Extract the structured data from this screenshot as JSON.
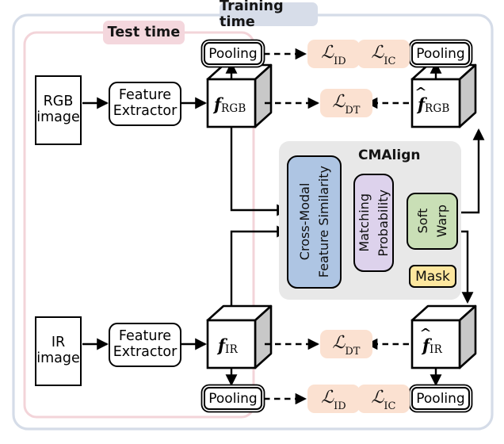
{
  "figure": {
    "kind": "architecture-diagram",
    "outer_frame_label": "Training time",
    "inner_frame_label": "Test time",
    "module_title": "CMAlign"
  },
  "colors": {
    "outer_frame_border": "#d5dce8",
    "outer_badge_bg": "#d7dde9",
    "inner_frame_border": "#f3d4d9",
    "inner_badge_bg": "#f4d7dd",
    "loss_bg": "#fbe1d1",
    "cmalign_bg": "#e8e8e8",
    "similarity_bg": "#aec5e3",
    "matching_bg": "#ddd2ec",
    "softwarp_bg": "#c9dfb6",
    "mask_bg": "#fde79f",
    "cube_side": "#c8c8c8",
    "cube_face": "#ffffff",
    "stroke": "#000000"
  },
  "rgb_branch": {
    "input_label_line1": "RGB",
    "input_label_line2": "image",
    "extractor_line1": "Feature",
    "extractor_line2": "Extractor",
    "feature_symbol": "f",
    "feature_subscript": "RGB",
    "pooling_label": "Pooling",
    "loss_id": "ID",
    "loss_dt": "DT"
  },
  "ir_branch": {
    "input_label_line1": "IR",
    "input_label_line2": "image",
    "extractor_line1": "Feature",
    "extractor_line2": "Extractor",
    "feature_symbol": "f",
    "feature_subscript": "IR",
    "pooling_label": "Pooling",
    "loss_id": "ID",
    "loss_dt": "DT"
  },
  "aligned_rgb": {
    "feature_symbol": "f",
    "feature_subscript": "RGB",
    "pooling_label": "Pooling",
    "loss_ic": "IC"
  },
  "aligned_ir": {
    "feature_symbol": "f",
    "feature_subscript": "IR",
    "pooling_label": "Pooling",
    "loss_ic": "IC"
  },
  "cmalign": {
    "title": "CMAlign",
    "similarity_line1": "Cross-Modal",
    "similarity_line2": "Feature Similarity",
    "matching_line1": "Matching",
    "matching_line2": "Probability",
    "softwarp_line1": "Soft",
    "softwarp_line2": "Warp",
    "mask_label": "Mask"
  },
  "loss_symbol": "ℒ",
  "losses": {
    "id_top": "ID",
    "ic_top": "IC",
    "dt_top": "DT",
    "dt_bottom": "DT",
    "id_bottom": "ID",
    "ic_bottom": "IC"
  }
}
